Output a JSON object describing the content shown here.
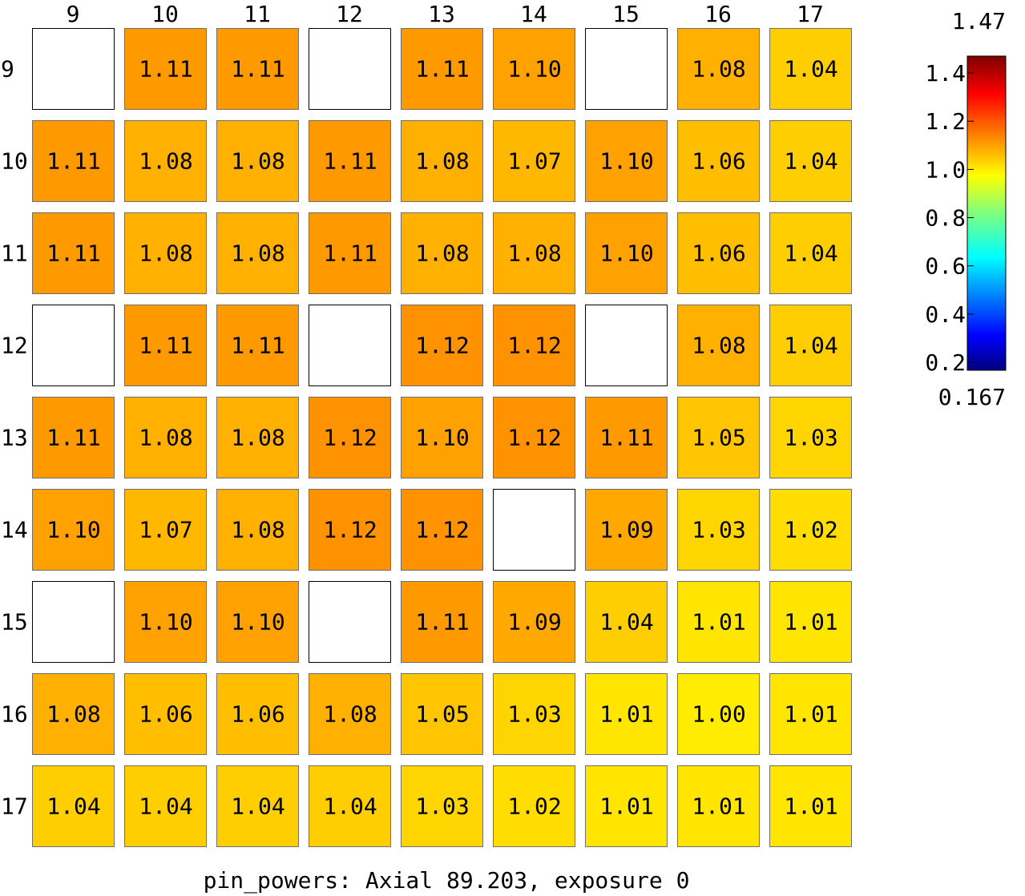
{
  "chart_data": {
    "type": "heatmap",
    "title": "pin_powers: Axial 89.203, exposure 0",
    "x_labels": [
      "9",
      "10",
      "11",
      "12",
      "13",
      "14",
      "15",
      "16",
      "17"
    ],
    "y_labels": [
      "9",
      "10",
      "11",
      "12",
      "13",
      "14",
      "15",
      "16",
      "17"
    ],
    "values": [
      [
        null,
        1.11,
        1.11,
        null,
        1.11,
        1.1,
        null,
        1.08,
        1.04
      ],
      [
        1.11,
        1.08,
        1.08,
        1.11,
        1.08,
        1.07,
        1.1,
        1.06,
        1.04
      ],
      [
        1.11,
        1.08,
        1.08,
        1.11,
        1.08,
        1.08,
        1.1,
        1.06,
        1.04
      ],
      [
        null,
        1.11,
        1.11,
        null,
        1.12,
        1.12,
        null,
        1.08,
        1.04
      ],
      [
        1.11,
        1.08,
        1.08,
        1.12,
        1.1,
        1.12,
        1.11,
        1.05,
        1.03
      ],
      [
        1.1,
        1.07,
        1.08,
        1.12,
        1.12,
        null,
        1.09,
        1.03,
        1.02
      ],
      [
        null,
        1.1,
        1.1,
        null,
        1.11,
        1.09,
        1.04,
        1.01,
        1.01
      ],
      [
        1.08,
        1.06,
        1.06,
        1.08,
        1.05,
        1.03,
        1.01,
        1.0,
        1.01
      ],
      [
        1.04,
        1.04,
        1.04,
        1.04,
        1.03,
        1.02,
        1.01,
        1.01,
        1.01
      ]
    ],
    "value_format_decimals": 2,
    "colorbar": {
      "colormap": "jet",
      "min": 0.167,
      "max": 1.47,
      "min_label": "0.167",
      "max_label": "1.47",
      "ticks": [
        0.2,
        0.4,
        0.6,
        0.8,
        1.0,
        1.2,
        1.4
      ],
      "tick_labels": [
        "0.2",
        "0.4",
        "0.6",
        "0.8",
        "1.0",
        "1.2",
        "1.4"
      ]
    },
    "empty_cell_color": "#ffffff",
    "grid": false
  }
}
